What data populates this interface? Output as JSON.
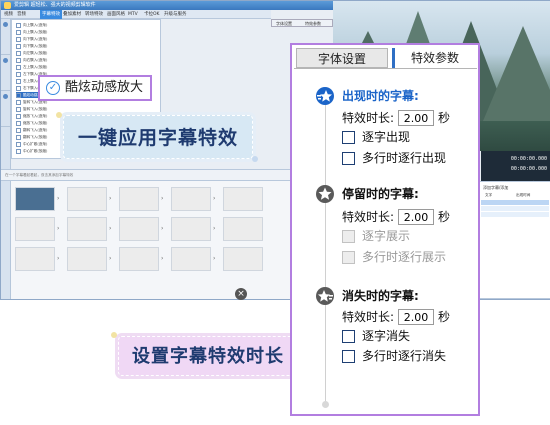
{
  "app": {
    "title": "爱剪辑   超轻松、强大的视频剪辑软件",
    "menu": [
      "视频",
      "音频",
      "字幕特效",
      "叠加素材",
      "转场特效",
      "画面风格",
      "MTV",
      "卡拉OK",
      "升级与服务"
    ],
    "active_menu_index": 2,
    "preview_tabs": [
      "字体设置",
      "特效参数"
    ],
    "effect_list": [
      "向上飘入(逐渐)",
      "向上飘入(放缩)",
      "向下飘入(逐渐)",
      "向下飘入(放缩)",
      "向左飘入(放缩)",
      "向右飘入(逐渐)",
      "左上飘入(放缩)",
      "左下飘入(逐渐)",
      "右上飘入(逐渐)",
      "右下飘入(放缩)",
      "酷炫动感放大",
      "旋转飞入(逐渐)",
      "旋转飞入(放缩)",
      "缩放飞入(逐渐)",
      "缩放飞入(放缩)",
      "翻转飞入(逐渐)",
      "翻转飞入(放缩)",
      "中心扩散(逐渐)",
      "中心扩散(放缩)"
    ],
    "selected_effect_index": 10,
    "bottom_hint": "在一个字幕看起看起，双击其添加字幕特效",
    "time_elapsed": "00:00:00.000",
    "time_total": "00:00:00.000",
    "export_label": "导出视频",
    "right_table_title": "添加字幕/添加",
    "right_table_headers": [
      "文字",
      "出现时间"
    ]
  },
  "highlight": {
    "check_icon": "check-circle-icon",
    "label": "酷炫动感放大"
  },
  "banners": {
    "top": "一键应用字幕特效",
    "bottom": "设置字幕特效时长"
  },
  "settings": {
    "tabs": [
      "字体设置",
      "特效参数"
    ],
    "active_tab": 0,
    "sections": [
      {
        "title": "出现时的字幕:",
        "icon": "star-enter-icon",
        "active": true,
        "duration_label": "特效时长:",
        "duration_value": "2.00",
        "unit": "秒",
        "options": [
          {
            "label": "逐字出现",
            "checked": false,
            "enabled": true
          },
          {
            "label": "多行时逐行出现",
            "checked": false,
            "enabled": true
          }
        ]
      },
      {
        "title": "停留时的字幕:",
        "icon": "star-stay-icon",
        "active": false,
        "duration_label": "特效时长:",
        "duration_value": "2.00",
        "unit": "秒",
        "options": [
          {
            "label": "逐字展示",
            "checked": false,
            "enabled": false
          },
          {
            "label": "多行时逐行展示",
            "checked": false,
            "enabled": false
          }
        ]
      },
      {
        "title": "消失时的字幕:",
        "icon": "star-exit-icon",
        "active": false,
        "duration_label": "特效时长:",
        "duration_value": "2.00",
        "unit": "秒",
        "options": [
          {
            "label": "逐字消失",
            "checked": false,
            "enabled": true
          },
          {
            "label": "多行时逐行消失",
            "checked": false,
            "enabled": true
          }
        ]
      }
    ]
  },
  "colors": {
    "accent": "#b27ee0",
    "active_title": "#1b64c8",
    "banner_text": "#1f3b70",
    "banner_top_bg": "#d7e8f4",
    "banner_bottom_bg": "#f0d8f5",
    "brand_blue": "#3a8be0"
  }
}
